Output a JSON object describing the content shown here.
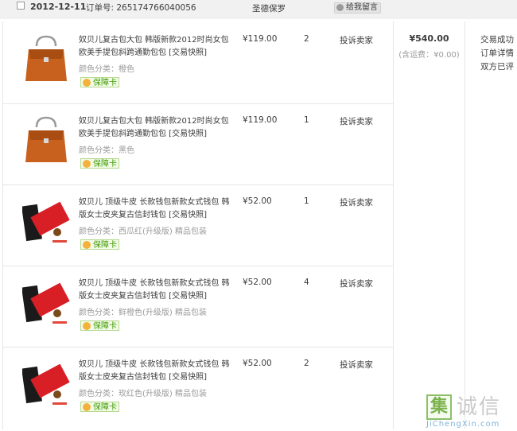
{
  "order": {
    "date": "2012-12-11",
    "order_no": "订单号: 265174766040056",
    "seller": "圣德保罗",
    "message_label": "给我留言"
  },
  "items": [
    {
      "title": "奴贝儿复古包大包 韩版新款2012时尚女包 欧美手提包斜跨通勤包包 [交易快照]",
      "sku": "颜色分类：橙色",
      "card": "保障卡",
      "price": "¥119.00",
      "qty": "2",
      "action": "投诉卖家",
      "thumb": "orange-handbag"
    },
    {
      "title": "奴贝儿复古包大包 韩版新款2012时尚女包 欧美手提包斜跨通勤包包 [交易快照]",
      "sku": "颜色分类：黑色",
      "card": "保障卡",
      "price": "¥119.00",
      "qty": "1",
      "action": "投诉卖家",
      "thumb": "orange-handbag"
    },
    {
      "title": "奴贝儿 顶级牛皮 长款钱包新款女式钱包 韩版女士皮夹复古信封钱包 [交易快照]",
      "sku": "颜色分类：西瓜红(升级版) 精品包装",
      "card": "保障卡",
      "price": "¥52.00",
      "qty": "1",
      "action": "投诉卖家",
      "thumb": "red-wallet"
    },
    {
      "title": "奴贝儿 顶级牛皮 长款钱包新款女式钱包 韩版女士皮夹复古信封钱包 [交易快照]",
      "sku": "颜色分类：鲜橙色(升级版) 精品包装",
      "card": "保障卡",
      "price": "¥52.00",
      "qty": "4",
      "action": "投诉卖家",
      "thumb": "red-wallet"
    },
    {
      "title": "奴贝儿 顶级牛皮 长款钱包新款女式钱包 韩版女士皮夹复古信封钱包 [交易快照]",
      "sku": "颜色分类：玫红色(升级版) 精品包装",
      "card": "保障卡",
      "price": "¥52.00",
      "qty": "2",
      "action": "投诉卖家",
      "thumb": "red-wallet"
    }
  ],
  "total": {
    "amount": "¥540.00",
    "shipping": "(含运费：¥0.00)"
  },
  "status": {
    "line1": "交易成功",
    "line2": "订单详情",
    "line3": "双方已评"
  },
  "watermark": {
    "box_char": "集",
    "text": "诚信",
    "url": "JiChengXin.com"
  },
  "colors": {
    "header_bg": "#f1f1f1",
    "card_green": "#3c9c00",
    "muted": "#9a9a9a"
  }
}
